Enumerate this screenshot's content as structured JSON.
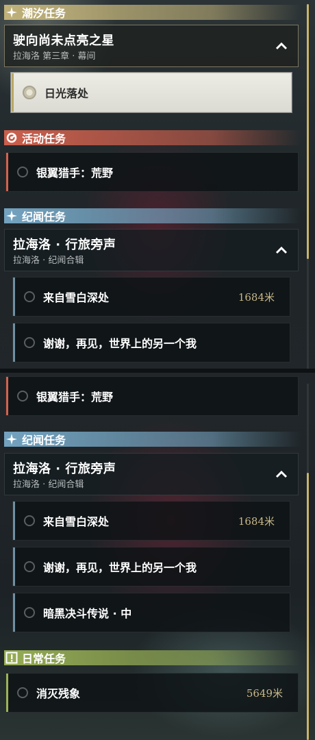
{
  "colors": {
    "tidal": "#c7b77c",
    "event": "#d4624e",
    "lore": "#78aac8",
    "daily": "#9cb456",
    "distance": "#c9b987"
  },
  "sections": {
    "tidal": {
      "label": "潮汐任务",
      "icon": "sparkle-icon"
    },
    "event": {
      "label": "活动任务",
      "icon": "event-swirl-icon"
    },
    "lore": {
      "label": "纪闻任务",
      "icon": "sparkle-icon"
    },
    "daily": {
      "label": "日常任务",
      "icon": "exclamation-icon"
    }
  },
  "tidal_chapter": {
    "title": "驶向尚未点亮之星",
    "subtitle": "拉海洛 第三章 · 幕间",
    "quests": [
      {
        "title": "日光落处"
      }
    ]
  },
  "event_quests": [
    {
      "title": "银翼猎手：荒野"
    }
  ],
  "lore_chapter": {
    "title": "拉海洛 · 行旅旁声",
    "subtitle": "拉海洛 · 纪闻合辑",
    "quests": [
      {
        "title": "来自雪白深处",
        "distance": "1684米"
      },
      {
        "title": "谢谢，再见，世界上的另一个我"
      },
      {
        "title": "暗黑决斗传说 · 中"
      }
    ]
  },
  "daily_quests": [
    {
      "title": "消灭残象",
      "distance": "5649米"
    }
  ]
}
